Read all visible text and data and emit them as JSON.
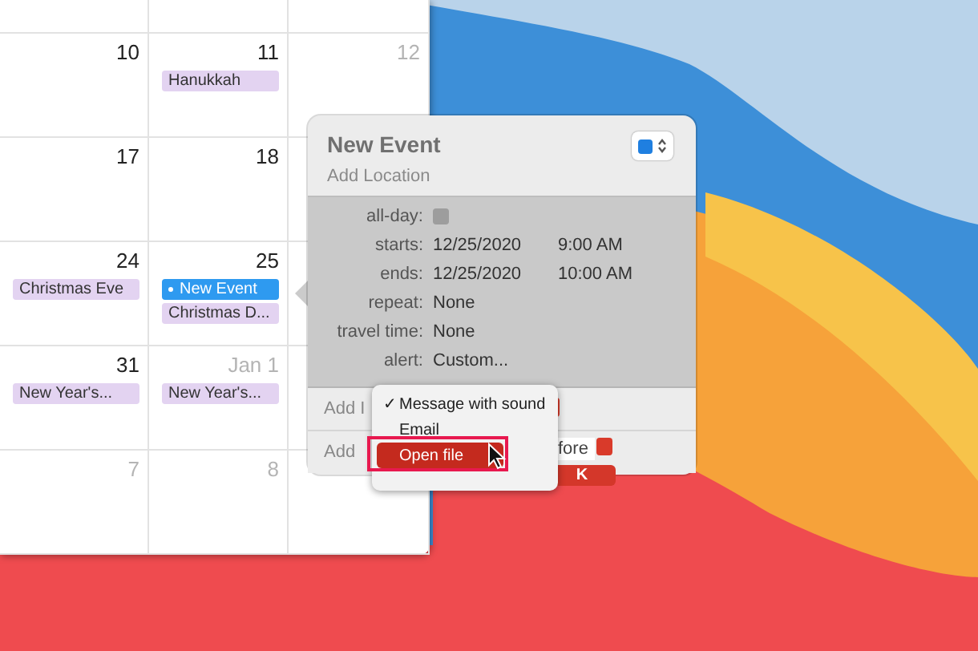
{
  "calendar": {
    "weeks": [
      {
        "days": [
          {
            "number": "10",
            "dimmed": false
          },
          {
            "number": "11",
            "dimmed": false,
            "events": [
              {
                "title": "Hanukkah",
                "selected": false
              }
            ]
          },
          {
            "number": "12",
            "dimmed": true
          }
        ]
      },
      {
        "days": [
          {
            "number": "17",
            "dimmed": false
          },
          {
            "number": "18",
            "dimmed": false
          }
        ]
      },
      {
        "days": [
          {
            "number": "24",
            "dimmed": false,
            "events": [
              {
                "title": "Christmas Eve",
                "selected": false
              }
            ]
          },
          {
            "number": "25",
            "dimmed": false,
            "events": [
              {
                "title": "New Event",
                "selected": true
              },
              {
                "title": "Christmas D...",
                "selected": false
              }
            ]
          }
        ]
      },
      {
        "days": [
          {
            "number": "31",
            "dimmed": false,
            "events": [
              {
                "title": "New Year's...",
                "selected": false
              }
            ]
          },
          {
            "number": "Jan 1",
            "dimmed": true,
            "events": [
              {
                "title": "New Year's...",
                "selected": false
              }
            ]
          }
        ]
      },
      {
        "days": [
          {
            "number": "7",
            "dimmed": true
          },
          {
            "number": "8",
            "dimmed": true
          }
        ]
      }
    ]
  },
  "popover": {
    "title": "New Event",
    "location_placeholder": "Add Location",
    "fields": [
      {
        "label": "all-day:",
        "kind": "checkbox",
        "checked": false
      },
      {
        "label": "starts:",
        "kind": "datetime",
        "date": "12/25/2020",
        "time": "9:00 AM"
      },
      {
        "label": "ends:",
        "kind": "datetime",
        "date": "12/25/2020",
        "time": "10:00 AM"
      },
      {
        "label": "repeat:",
        "kind": "text",
        "value": "None"
      },
      {
        "label": "travel time:",
        "kind": "text",
        "value": "None"
      },
      {
        "label": "alert:",
        "kind": "text",
        "value": "Custom..."
      }
    ],
    "footer_rows": [
      "Add I",
      "Add"
    ],
    "alert_timing": "fore",
    "ok_button": "K"
  },
  "alert_menu": {
    "check_glyph": "✓",
    "items": [
      {
        "label": "Message with sound",
        "checked": true,
        "selected": false
      },
      {
        "label": "Email",
        "checked": false,
        "selected": false
      },
      {
        "label": "Open file",
        "checked": false,
        "selected": true
      }
    ]
  }
}
